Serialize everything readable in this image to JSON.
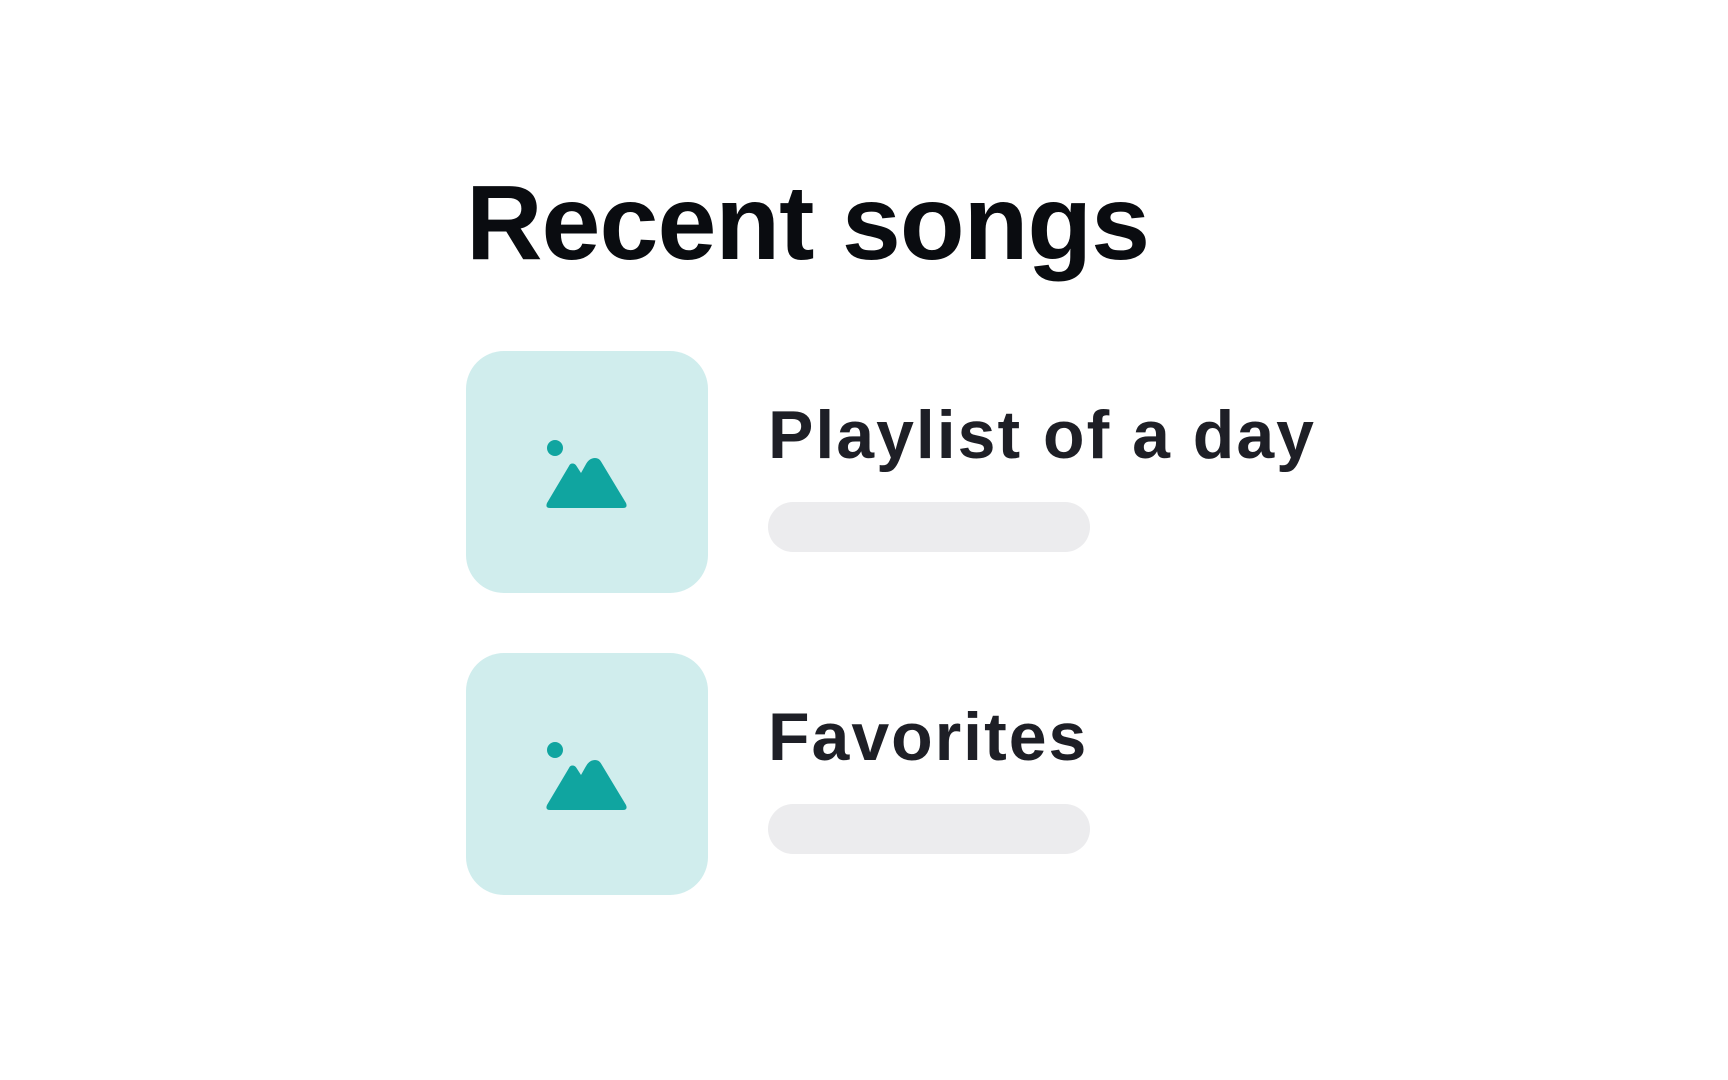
{
  "page": {
    "title": "Recent songs"
  },
  "songs": [
    {
      "title": "Playlist of a day",
      "thumbnail_icon": "image-placeholder-icon"
    },
    {
      "title": "Favorites",
      "thumbnail_icon": "image-placeholder-icon"
    }
  ],
  "colors": {
    "thumbnail_bg": "#d0eded",
    "icon_accent": "#10a5a0",
    "placeholder_bar": "#ececee",
    "heading_text": "#0a0c10"
  }
}
